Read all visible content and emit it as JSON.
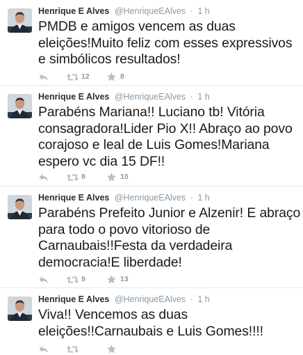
{
  "tweets": [
    {
      "name": "Henrique E Alves",
      "handle": "@HenriqueEAlves",
      "separator": "·",
      "time": "1 h",
      "text": "PMDB e amigos vencem as duas eleições!Muito feliz com esses expressivos e simbólicos resultados!",
      "retweets": "12",
      "favorites": "8"
    },
    {
      "name": "Henrique E Alves",
      "handle": "@HenriqueEAlves",
      "separator": "·",
      "time": "1 h",
      "text": "Parabéns Mariana!! Luciano tb! Vitória consagradora!Lider Pio X!! Abraço ao povo corajoso e leal de Luis Gomes!Mariana espero vc dia 15 DF!!",
      "retweets": "8",
      "favorites": "10"
    },
    {
      "name": "Henrique E Alves",
      "handle": "@HenriqueEAlves",
      "separator": "·",
      "time": "1 h",
      "text": "Parabéns Prefeito Junior e Alzenir! E abraço para todo o povo vitorioso de Carnaubais!!Festa da verdadeira democracia!E liberdade!",
      "retweets": "9",
      "favorites": "13"
    },
    {
      "name": "Henrique E Alves",
      "handle": "@HenriqueEAlves",
      "separator": "·",
      "time": "1 h",
      "text": "Viva!! Vencemos as duas eleições!!Carnaubais e Luis Gomes!!!!",
      "retweets": "",
      "favorites": ""
    }
  ],
  "icons": {
    "reply": "reply-icon",
    "retweet": "retweet-icon",
    "favorite": "star-icon"
  },
  "colors": {
    "meta": "#8899a6",
    "divider": "#e1e8ed",
    "text": "#1a1a1a"
  }
}
